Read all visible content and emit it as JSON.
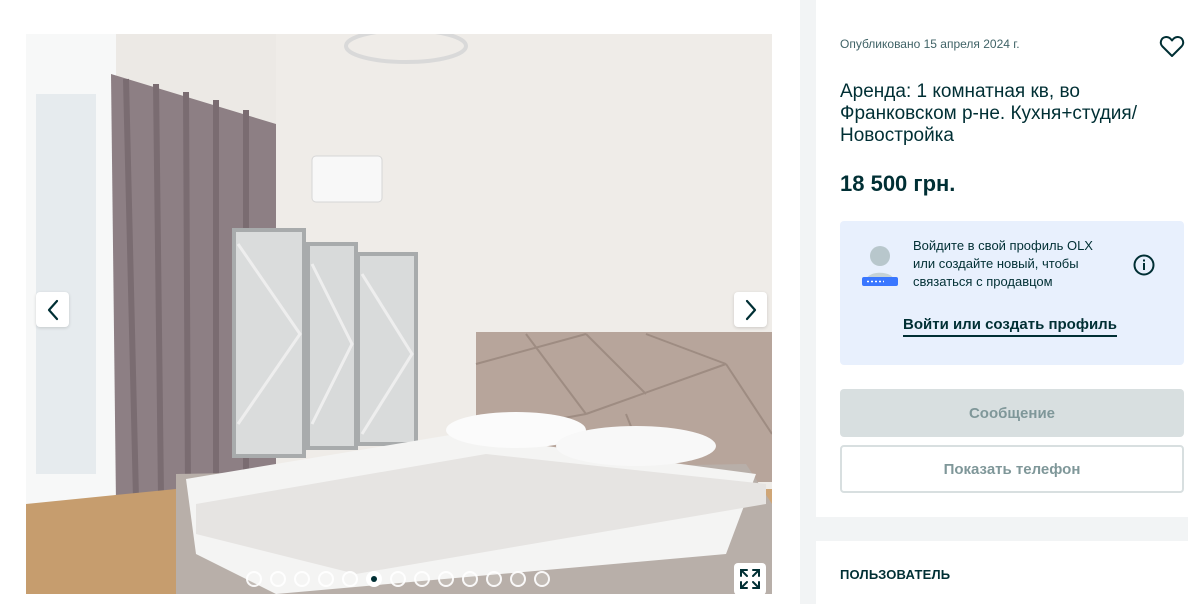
{
  "gallery": {
    "photo_alt": "Фото квартиры",
    "prev_icon": "chevron-left-icon",
    "next_icon": "chevron-right-icon",
    "expand_icon": "expand-icon",
    "dots_count": 13,
    "active_index": 5
  },
  "ad": {
    "published": "Опубликовано 15 апреля 2024 г.",
    "title": "Аренда: 1 комнатная кв, во Франковском р-не. Кухня+студия/ Новостройка",
    "price": "18 500 грн.",
    "favorite_icon": "heart-icon"
  },
  "login_prompt": {
    "text": "Войдите в свой профиль OLX или создайте новый, чтобы связаться с продавцом",
    "link": "Войти или создать профиль",
    "info_icon": "info-icon"
  },
  "actions": {
    "message": "Сообщение",
    "show_phone": "Показать телефон"
  },
  "user": {
    "heading": "ПОЛЬЗОВАТЕЛЬ"
  },
  "colors": {
    "brand_dark": "#002f34",
    "login_bg": "#e8f0fd",
    "disabled_bg": "#d8dfe0",
    "page_bg": "#f2f4f5"
  }
}
